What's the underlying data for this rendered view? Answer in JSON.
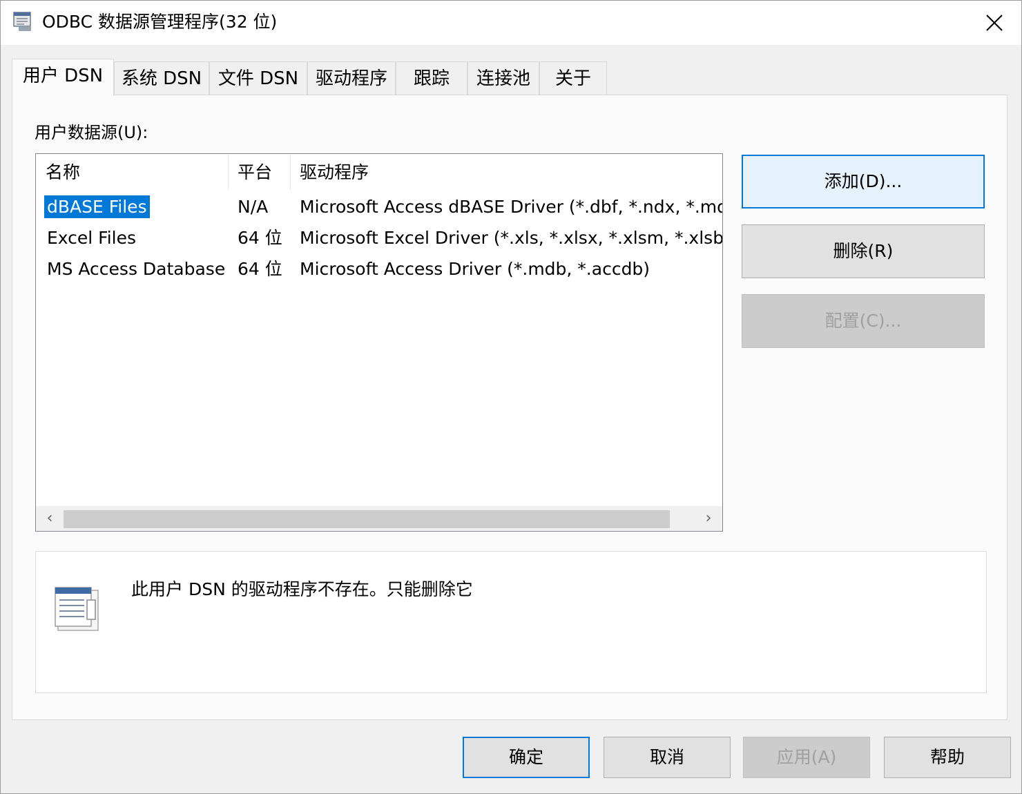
{
  "window": {
    "title": "ODBC 数据源管理程序(32 位)"
  },
  "tabs": [
    {
      "label": "用户 DSN",
      "active": true
    },
    {
      "label": "系统 DSN",
      "active": false
    },
    {
      "label": "文件 DSN",
      "active": false
    },
    {
      "label": "驱动程序",
      "active": false
    },
    {
      "label": "跟踪",
      "active": false
    },
    {
      "label": "连接池",
      "active": false
    },
    {
      "label": "关于",
      "active": false
    }
  ],
  "user_dsn": {
    "section_label": "用户数据源(U):",
    "columns": [
      "名称",
      "平台",
      "驱动程序"
    ],
    "rows": [
      {
        "name": "dBASE Files",
        "platform": "N/A",
        "driver": "Microsoft Access dBASE Driver (*.dbf, *.ndx, *.mdx)",
        "selected": true
      },
      {
        "name": "Excel Files",
        "platform": "64 位",
        "driver": "Microsoft Excel Driver (*.xls, *.xlsx, *.xlsm, *.xlsb)",
        "selected": false
      },
      {
        "name": "MS Access Database",
        "platform": "64 位",
        "driver": "Microsoft Access Driver (*.mdb, *.accdb)",
        "selected": false
      }
    ],
    "buttons": {
      "add": "添加(D)...",
      "remove": "删除(R)",
      "configure": "配置(C)..."
    },
    "description": "此用户 DSN 的驱动程序不存在。只能删除它"
  },
  "footer_buttons": {
    "ok": "确定",
    "cancel": "取消",
    "apply": "应用(A)",
    "help": "帮助"
  },
  "colors": {
    "selection": "#0078d7",
    "focus_border": "#0078d7"
  }
}
